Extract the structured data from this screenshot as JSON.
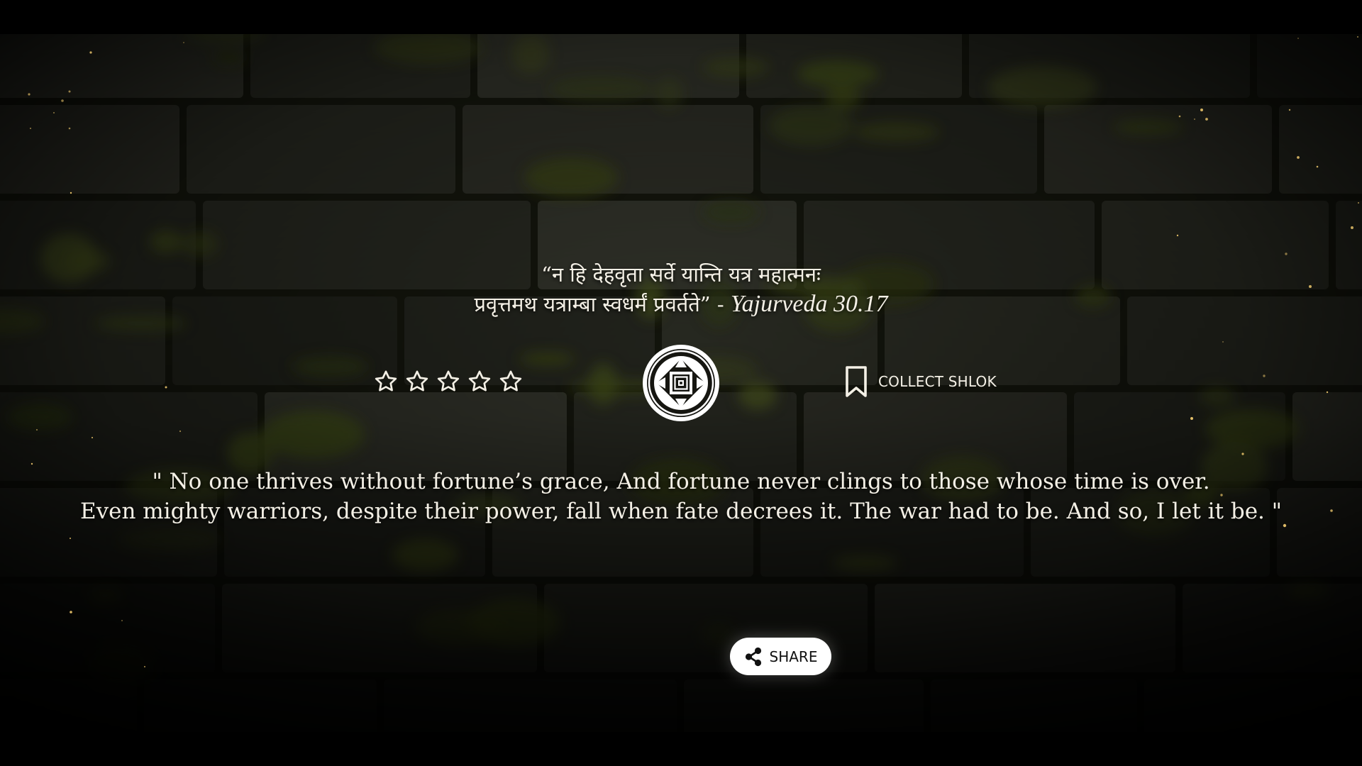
{
  "quote": {
    "sanskrit_line_1": "“न हि देहवृता सर्वे यान्ति यत्र महात्मनः",
    "sanskrit_line_2": "प्रवृत्तमथ यत्राम्बा स्वधर्मं प्रवर्तते” - ",
    "source": "Yajurveda 30.17",
    "translation_line_1": "\" No one thrives without fortune’s grace, And fortune never clings to those whose time is over.",
    "translation_line_2": "Even mighty warriors, despite their power, fall when fate decrees it. The war had to be. And so, I let it be. \""
  },
  "rating": {
    "max_stars": 5,
    "value": 0,
    "star_icon": "star-outline-icon"
  },
  "emblem": {
    "icon": "mandala-emblem-icon"
  },
  "collect": {
    "label": "COLLECT SHLOK",
    "icon": "bookmark-icon"
  },
  "share": {
    "label": "SHARE",
    "icon": "share-icon"
  },
  "colors": {
    "text": "#f4f0e6",
    "button_bg": "#ffffff",
    "button_text": "#111111",
    "background": "#000000",
    "moss": "#4d5a1e"
  }
}
